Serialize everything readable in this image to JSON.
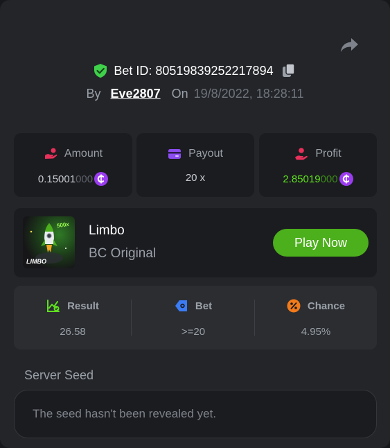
{
  "header": {
    "bet_id_label": "Bet ID: 80519839252217894",
    "by_label": "By",
    "username": "Eve2807",
    "on_label": "On",
    "timestamp": "19/8/2022, 18:28:11"
  },
  "stats": [
    {
      "label": "Amount",
      "value_main": "0.15001",
      "value_dim": "000",
      "has_coin": true,
      "icon": "amount-icon",
      "color": "#e8305a"
    },
    {
      "label": "Payout",
      "value_main": "20 x",
      "value_dim": "",
      "has_coin": false,
      "icon": "payout-card-icon",
      "color": "#8b4cf0"
    },
    {
      "label": "Profit",
      "value_main": "2.85019",
      "value_dim": "000",
      "has_coin": true,
      "icon": "profit-icon",
      "color": "#e8305a"
    }
  ],
  "game": {
    "name": "Limbo",
    "subtitle": "BC Original",
    "thumb_caption": "LIMBO",
    "thumb_badge": "500x",
    "play_label": "Play Now"
  },
  "result": [
    {
      "label": "Result",
      "value": "26.58",
      "icon": "chart-check-icon",
      "color": "#5ee01e"
    },
    {
      "label": "Bet",
      "value": ">=20",
      "icon": "bet-diamond-icon",
      "color": "#3b7cf5"
    },
    {
      "label": "Chance",
      "value": "4.95%",
      "icon": "percent-icon",
      "color": "#f27a1a"
    }
  ],
  "server_seed": {
    "label": "Server Seed",
    "text": "The seed hasn't been revealed yet."
  },
  "colors": {
    "accent_green": "#4caf1c",
    "profit_green": "#5ee01e",
    "coin_purple": "#9a3cf0"
  }
}
